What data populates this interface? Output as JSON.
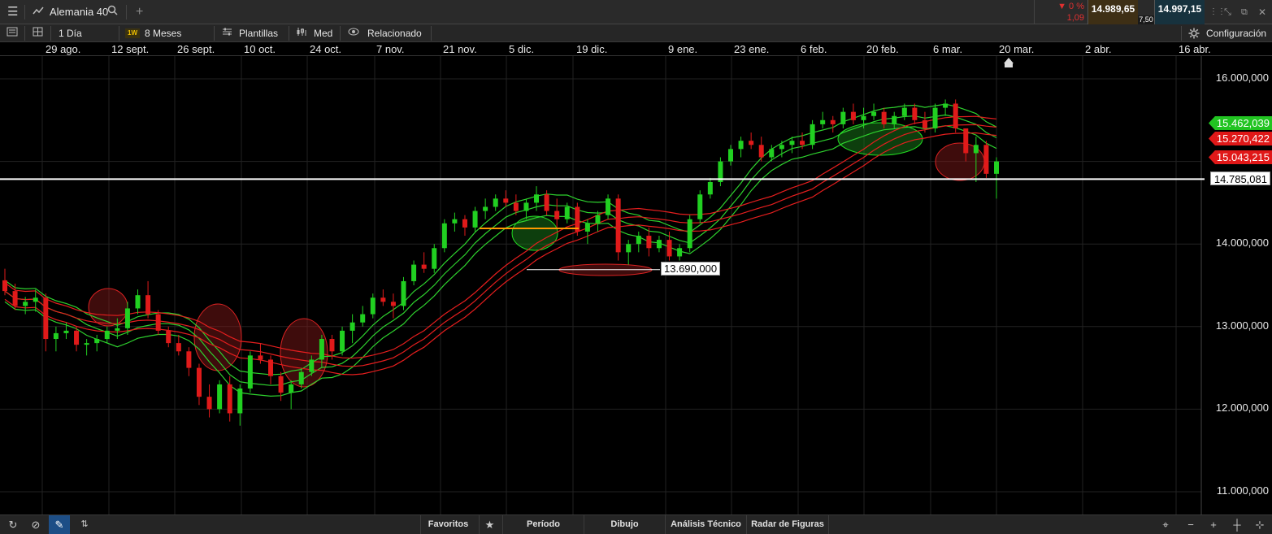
{
  "header": {
    "menu_icon": "hamburger-menu-icon",
    "chart_icon": "line-chart-icon",
    "instrument": "Alemania 40",
    "search_icon": "search-icon",
    "add_tab": "+",
    "change_pct": "▼ 0 %",
    "change_abs": "1,09",
    "bid": "14.989,65",
    "spread": "7,50",
    "ask": "14.997,15",
    "window_icons": [
      "minimize-icon",
      "restore-icon",
      "popout-icon",
      "close-icon"
    ]
  },
  "toolbar": {
    "period": "1 Día",
    "badge": "1W",
    "range": "8 Meses",
    "templates": "Plantillas",
    "price_type": "Med",
    "related": "Relacionado",
    "settings": "Configuración"
  },
  "dates": [
    "29 ago.",
    "12 sept.",
    "26 sept.",
    "10 oct.",
    "24 oct.",
    "7 nov.",
    "21 nov.",
    "5 dic.",
    "19 dic.",
    "9 ene.",
    "23 ene.",
    "6 feb.",
    "20 feb.",
    "6 mar.",
    "20 mar.",
    "2 abr.",
    "16 abr."
  ],
  "price_axis": [
    "16.000,000",
    "14.000,000",
    "13.000,000",
    "12.000,000",
    "11.000,000"
  ],
  "price_tags": {
    "green": "15.462,039",
    "red1": "15.270,422",
    "red2": "15.043,215",
    "white": "14.785,081",
    "annotation": "13.690,000"
  },
  "colors": {
    "up": "#21d021",
    "down": "#e01a1a",
    "ma_green": "#2ed12e",
    "ma_red": "#e51e1e",
    "bg": "#000000"
  },
  "bottom": {
    "tools": [
      "refresh-icon",
      "disable-icon",
      "pencil-icon",
      "sort-icon"
    ],
    "favorites": "Favoritos",
    "star_icon": "star-icon",
    "period": "Período",
    "drawing": "Dibujo",
    "technical": "Análisis Técnico",
    "patterns": "Radar de Figuras",
    "right_icons": [
      "crosshair-add-icon",
      "zoom-out-icon",
      "zoom-in-icon",
      "crosshair-icon",
      "fit-icon"
    ]
  },
  "chart_data": {
    "type": "candlestick",
    "instrument": "Alemania 40",
    "interval": "1 Día",
    "y_axis_ticks": [
      16000,
      14000,
      13000,
      12000,
      11000
    ],
    "ylim": [
      10700,
      16350
    ],
    "horizontal_line": 14785.081,
    "annotation_line": 13690,
    "grid": true,
    "candles": [
      [
        13560,
        13700,
        13380,
        13430
      ],
      [
        13430,
        13520,
        13200,
        13250
      ],
      [
        13250,
        13360,
        13150,
        13300
      ],
      [
        13300,
        13450,
        13180,
        13350
      ],
      [
        13350,
        13400,
        12700,
        12850
      ],
      [
        12850,
        13000,
        12700,
        12920
      ],
      [
        12920,
        13050,
        12850,
        12950
      ],
      [
        12950,
        13000,
        12700,
        12780
      ],
      [
        12780,
        12850,
        12650,
        12800
      ],
      [
        12800,
        12900,
        12700,
        12850
      ],
      [
        12850,
        13000,
        12800,
        12950
      ],
      [
        12950,
        13100,
        12850,
        12980
      ],
      [
        12980,
        13300,
        12900,
        13220
      ],
      [
        13220,
        13450,
        13150,
        13380
      ],
      [
        13380,
        13550,
        13100,
        13150
      ],
      [
        13150,
        13200,
        12900,
        12950
      ],
      [
        12950,
        13000,
        12750,
        12800
      ],
      [
        12800,
        12900,
        12650,
        12700
      ],
      [
        12700,
        12750,
        12400,
        12500
      ],
      [
        12500,
        12550,
        12050,
        12150
      ],
      [
        12150,
        12300,
        11900,
        12000
      ],
      [
        12000,
        12350,
        11950,
        12300
      ],
      [
        12300,
        12400,
        11850,
        11950
      ],
      [
        11950,
        12300,
        11800,
        12250
      ],
      [
        12250,
        12700,
        12200,
        12650
      ],
      [
        12650,
        12800,
        12550,
        12600
      ],
      [
        12600,
        12650,
        12300,
        12400
      ],
      [
        12400,
        12450,
        12100,
        12200
      ],
      [
        12200,
        12350,
        12000,
        12300
      ],
      [
        12300,
        12500,
        12250,
        12450
      ],
      [
        12450,
        12650,
        12400,
        12600
      ],
      [
        12600,
        12900,
        12500,
        12850
      ],
      [
        12850,
        12900,
        12600,
        12700
      ],
      [
        12700,
        13000,
        12650,
        12950
      ],
      [
        12950,
        13150,
        12800,
        13050
      ],
      [
        13050,
        13250,
        13000,
        13150
      ],
      [
        13150,
        13400,
        13100,
        13350
      ],
      [
        13350,
        13450,
        13250,
        13300
      ],
      [
        13300,
        13400,
        13100,
        13250
      ],
      [
        13250,
        13600,
        13200,
        13550
      ],
      [
        13550,
        13800,
        13500,
        13750
      ],
      [
        13750,
        13900,
        13650,
        13700
      ],
      [
        13700,
        14000,
        13650,
        13950
      ],
      [
        13950,
        14300,
        13900,
        14250
      ],
      [
        14250,
        14380,
        14150,
        14300
      ],
      [
        14300,
        14350,
        14100,
        14200
      ],
      [
        14200,
        14450,
        14150,
        14400
      ],
      [
        14400,
        14550,
        14300,
        14450
      ],
      [
        14450,
        14600,
        14400,
        14550
      ],
      [
        14550,
        14650,
        14450,
        14500
      ],
      [
        14500,
        14600,
        14350,
        14400
      ],
      [
        14400,
        14550,
        14300,
        14500
      ],
      [
        14500,
        14700,
        14400,
        14600
      ],
      [
        14600,
        14650,
        14350,
        14400
      ],
      [
        14400,
        14550,
        14200,
        14300
      ],
      [
        14300,
        14500,
        14250,
        14450
      ],
      [
        14450,
        14500,
        14100,
        14150
      ],
      [
        14150,
        14300,
        14000,
        14250
      ],
      [
        14250,
        14400,
        14150,
        14350
      ],
      [
        14350,
        14600,
        14300,
        14550
      ],
      [
        14550,
        14600,
        13800,
        13900
      ],
      [
        13900,
        14050,
        13750,
        14000
      ],
      [
        14000,
        14150,
        13900,
        14100
      ],
      [
        14100,
        14200,
        13850,
        13950
      ],
      [
        13950,
        14100,
        13900,
        14050
      ],
      [
        14050,
        14150,
        13800,
        13850
      ],
      [
        13850,
        14000,
        13800,
        13950
      ],
      [
        13950,
        14350,
        13900,
        14300
      ],
      [
        14300,
        14650,
        14250,
        14600
      ],
      [
        14600,
        14800,
        14550,
        14750
      ],
      [
        14750,
        15050,
        14700,
        15000
      ],
      [
        15000,
        15200,
        14950,
        15150
      ],
      [
        15150,
        15300,
        15050,
        15250
      ],
      [
        15250,
        15350,
        15150,
        15200
      ],
      [
        15200,
        15300,
        15000,
        15050
      ],
      [
        15050,
        15200,
        15000,
        15150
      ],
      [
        15150,
        15250,
        15050,
        15200
      ],
      [
        15200,
        15300,
        15100,
        15250
      ],
      [
        15250,
        15350,
        15150,
        15200
      ],
      [
        15200,
        15500,
        15150,
        15450
      ],
      [
        15450,
        15600,
        15400,
        15500
      ],
      [
        15500,
        15550,
        15350,
        15450
      ],
      [
        15450,
        15650,
        15400,
        15600
      ],
      [
        15600,
        15700,
        15450,
        15500
      ],
      [
        15500,
        15650,
        15400,
        15550
      ],
      [
        15550,
        15700,
        15500,
        15600
      ],
      [
        15600,
        15650,
        15400,
        15450
      ],
      [
        15450,
        15600,
        15400,
        15550
      ],
      [
        15550,
        15700,
        15500,
        15650
      ],
      [
        15650,
        15700,
        15450,
        15500
      ],
      [
        15500,
        15600,
        15350,
        15400
      ],
      [
        15400,
        15700,
        15350,
        15650
      ],
      [
        15650,
        15750,
        15550,
        15700
      ],
      [
        15700,
        15750,
        15350,
        15400
      ],
      [
        15400,
        15300,
        15000,
        15100
      ],
      [
        15100,
        15300,
        14750,
        15200
      ],
      [
        15200,
        15250,
        14800,
        14850
      ],
      [
        14850,
        15050,
        14550,
        15000
      ]
    ]
  }
}
